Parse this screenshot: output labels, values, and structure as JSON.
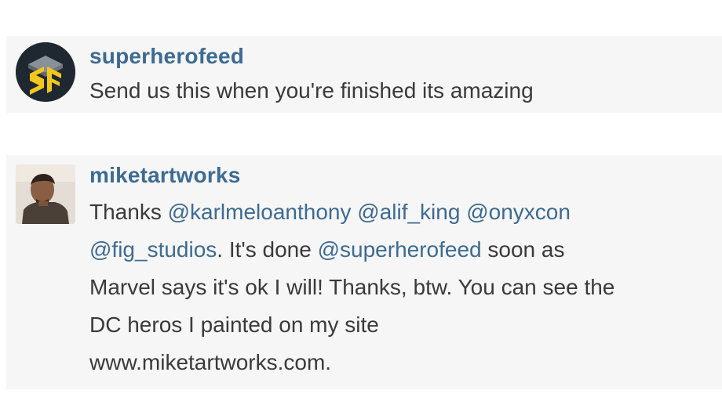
{
  "comments": [
    {
      "username": "superherofeed",
      "avatar_icon": "sf-logo-icon",
      "text": "Send us this when you're finished its amazing"
    },
    {
      "username": "miketartworks",
      "avatar_icon": "user-photo",
      "text_parts": {
        "p0": "Thanks ",
        "m0": "@karlmeloanthony",
        "p1": " ",
        "m1": "@alif_king",
        "p2": " ",
        "m2": "@onyxcon",
        "m3": "@fig_studios",
        "p3": ". It's done ",
        "m4": "@superherofeed",
        "p4": " soon as",
        "l3": "Marvel says it's ok I will! Thanks, btw. You can see the",
        "l4": "DC heros I painted on my site",
        "l5": "www.miketartworks.com."
      }
    }
  ],
  "colors": {
    "username": "#3d6b92",
    "mention": "#3d6b92",
    "text": "#3a3a3a",
    "row_bg": "#f6f6f6"
  }
}
